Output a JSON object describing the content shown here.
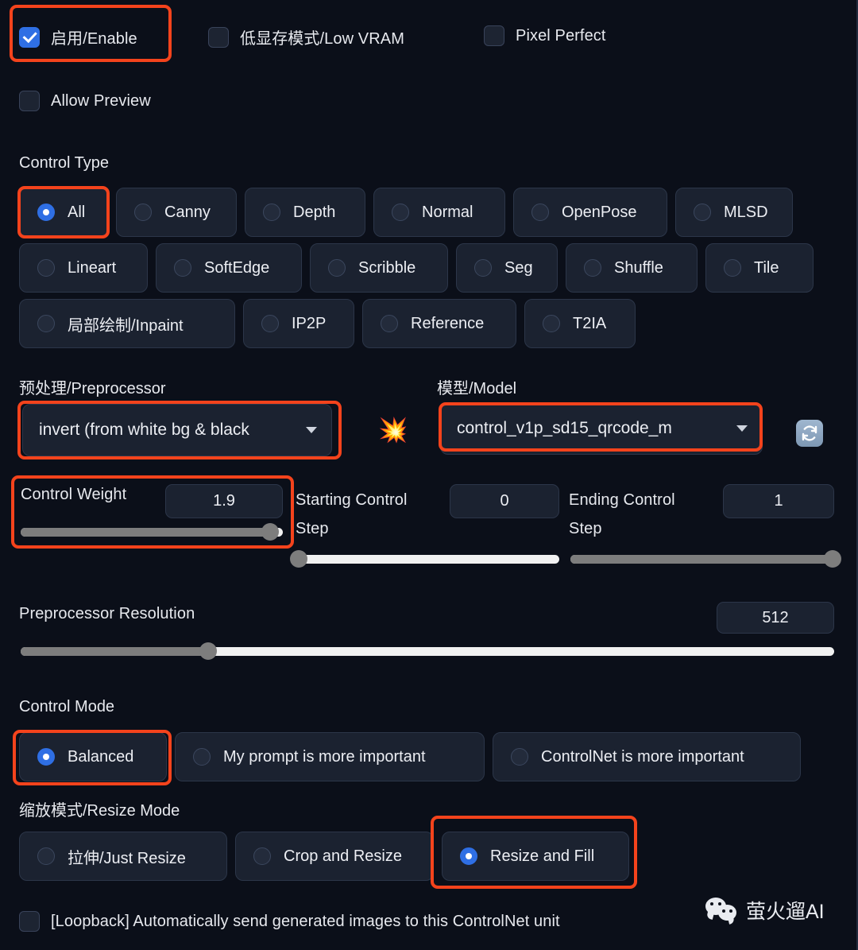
{
  "top_checkboxes": [
    {
      "label": "启用/Enable",
      "checked": true
    },
    {
      "label": "低显存模式/Low VRAM",
      "checked": false
    },
    {
      "label": "Pixel Perfect",
      "checked": false
    }
  ],
  "allow_preview": {
    "label": "Allow Preview",
    "checked": false
  },
  "control_type": {
    "label": "Control Type",
    "rows": [
      [
        {
          "label": "All",
          "selected": true
        },
        {
          "label": "Canny",
          "selected": false
        },
        {
          "label": "Depth",
          "selected": false
        },
        {
          "label": "Normal",
          "selected": false
        },
        {
          "label": "OpenPose",
          "selected": false
        },
        {
          "label": "MLSD",
          "selected": false
        }
      ],
      [
        {
          "label": "Lineart",
          "selected": false
        },
        {
          "label": "SoftEdge",
          "selected": false
        },
        {
          "label": "Scribble",
          "selected": false
        },
        {
          "label": "Seg",
          "selected": false
        },
        {
          "label": "Shuffle",
          "selected": false
        },
        {
          "label": "Tile",
          "selected": false
        }
      ],
      [
        {
          "label": "局部绘制/Inpaint",
          "selected": false
        },
        {
          "label": "IP2P",
          "selected": false
        },
        {
          "label": "Reference",
          "selected": false
        },
        {
          "label": "T2IA",
          "selected": false
        }
      ]
    ]
  },
  "preprocessor": {
    "label": "预处理/Preprocessor",
    "value": "invert (from white bg & black"
  },
  "model": {
    "label": "模型/Model",
    "value": "control_v1p_sd15_qrcode_m"
  },
  "icons": {
    "boom": "💥",
    "refresh": "refresh-icon"
  },
  "sliders": {
    "control_weight": {
      "label": "Control Weight",
      "value": "1.9",
      "percent": 95
    },
    "starting_control_step": {
      "label": "Starting Control Step",
      "value": "0",
      "percent": 0
    },
    "ending_control_step": {
      "label": "Ending Control Step",
      "value": "1",
      "percent": 100
    },
    "preprocessor_resolution": {
      "label": "Preprocessor Resolution",
      "value": "512",
      "percent": 23
    }
  },
  "control_mode": {
    "label": "Control Mode",
    "options": [
      {
        "label": "Balanced",
        "selected": true
      },
      {
        "label": "My prompt is more important",
        "selected": false
      },
      {
        "label": "ControlNet is more important",
        "selected": false
      }
    ]
  },
  "resize_mode": {
    "label": "缩放模式/Resize Mode",
    "options": [
      {
        "label": "拉伸/Just Resize",
        "selected": false
      },
      {
        "label": "Crop and Resize",
        "selected": false
      },
      {
        "label": "Resize and Fill",
        "selected": true
      }
    ]
  },
  "loopback": {
    "label": "[Loopback] Automatically send generated images to this ControlNet unit",
    "checked": false
  },
  "watermark": {
    "text": "萤火遛AI"
  },
  "colors": {
    "accent_blue": "#2f6fe4",
    "annotation_red": "#f4431c",
    "panel_bg": "#0b0f19",
    "pill_bg": "#1b2230"
  }
}
